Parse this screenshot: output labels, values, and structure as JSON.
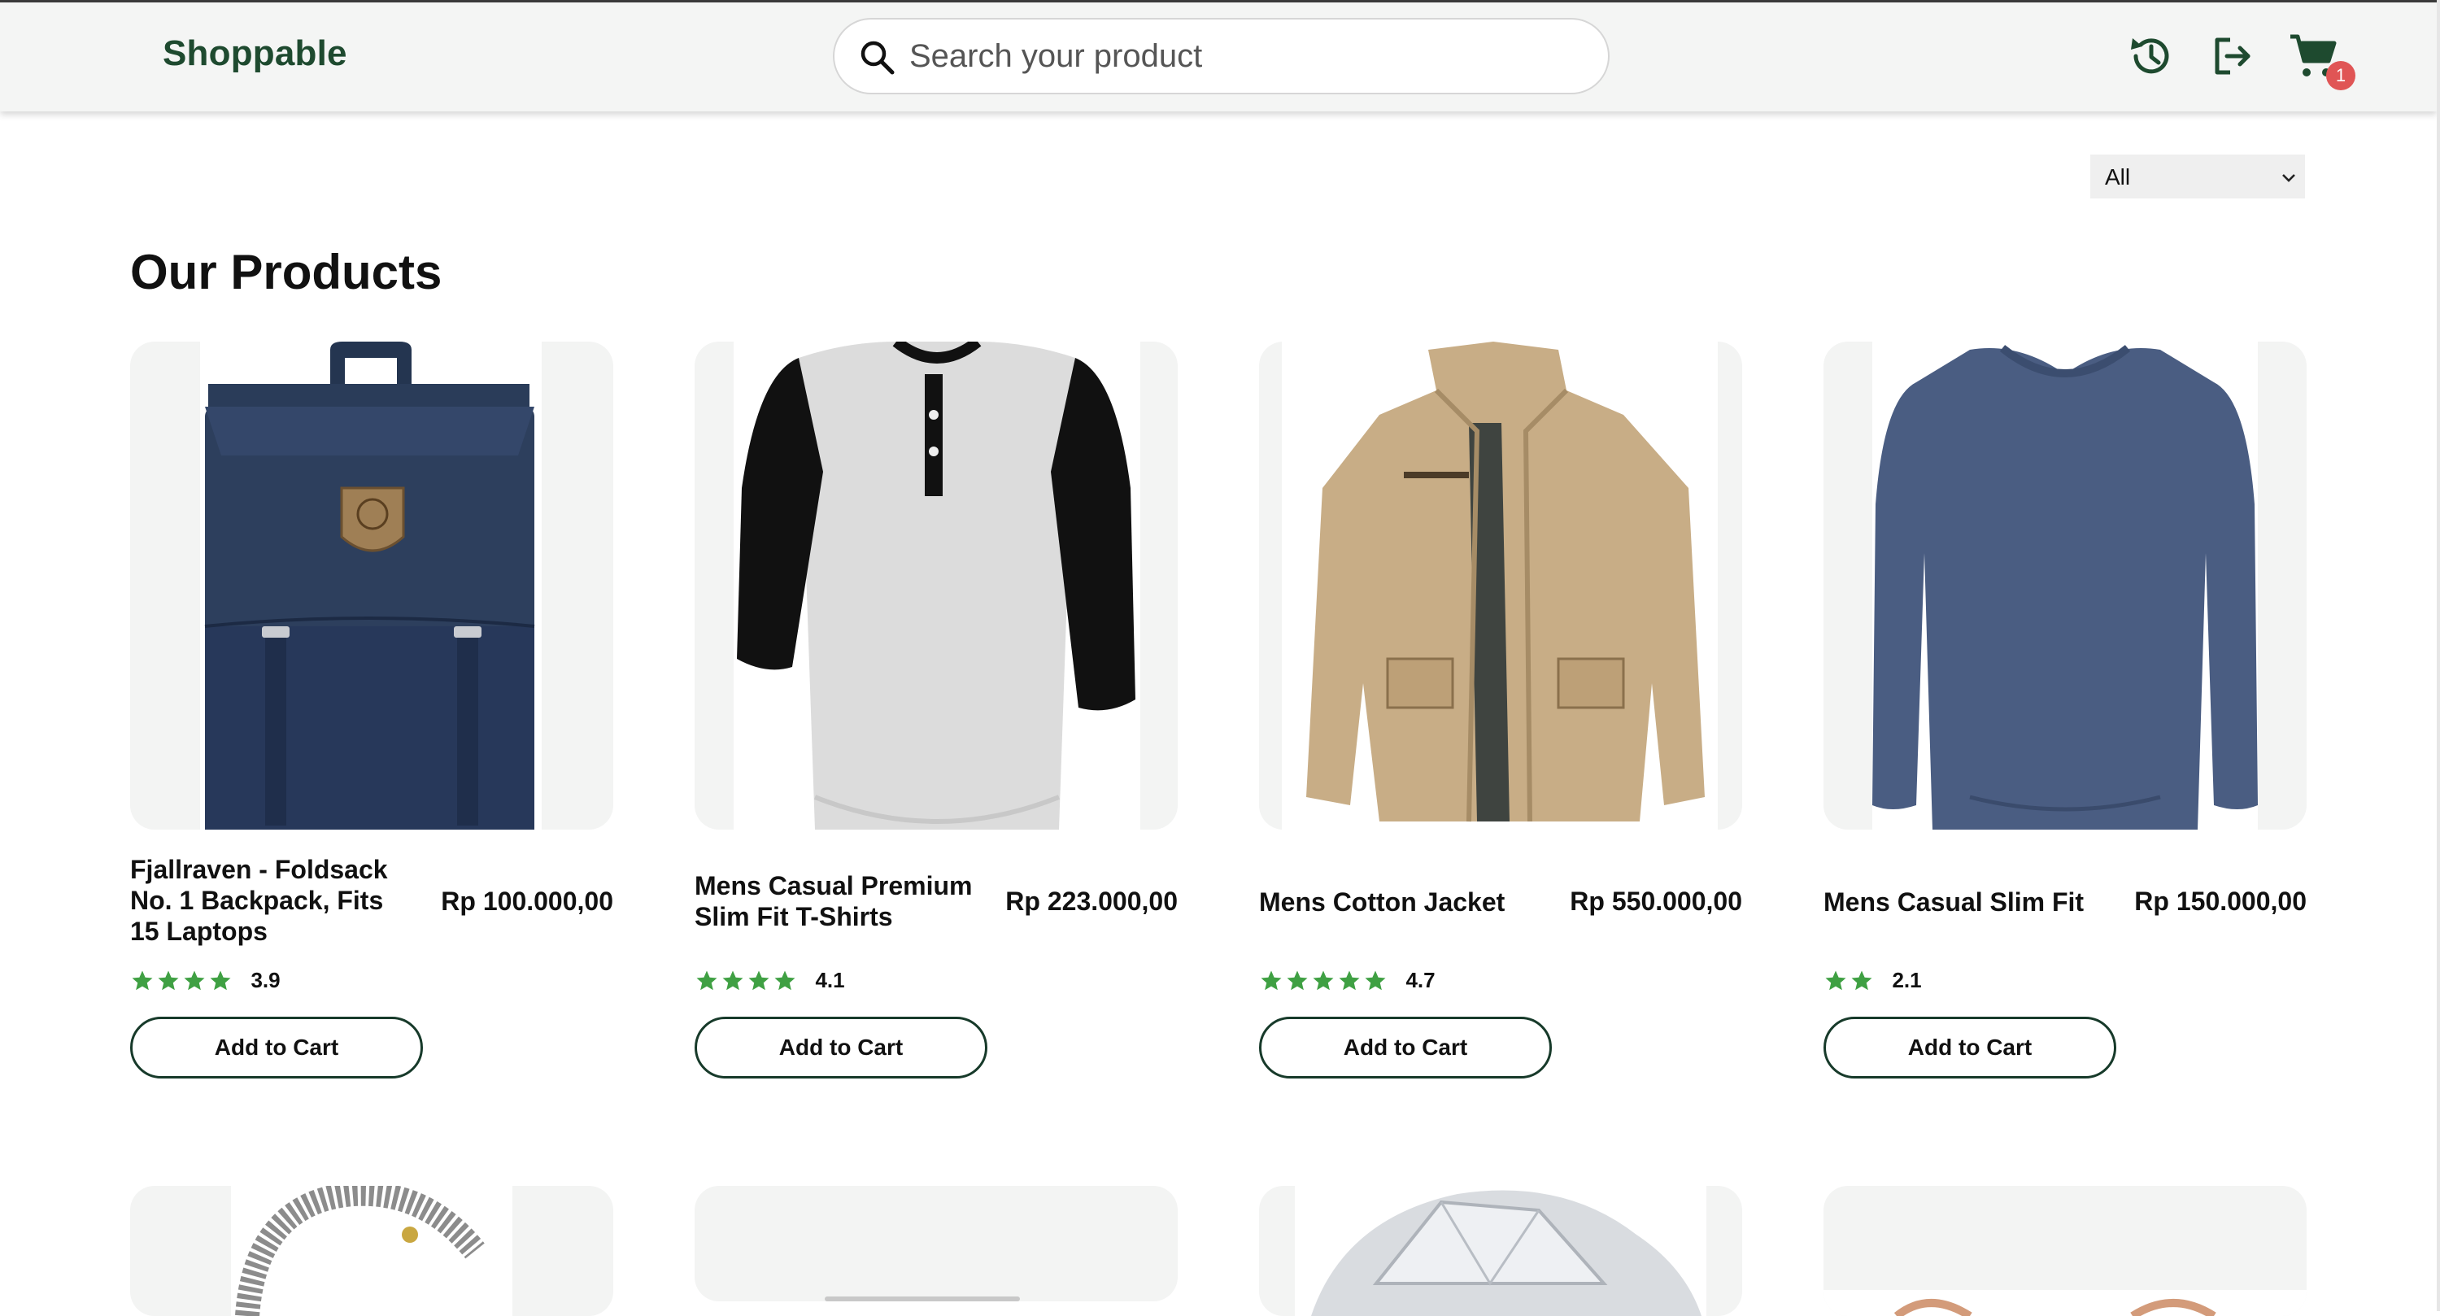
{
  "header": {
    "brand": "Shoppable",
    "search_placeholder": "Search your product",
    "cart_count": "1",
    "icons": [
      "history-icon",
      "logout-icon",
      "cart-icon"
    ]
  },
  "filter": {
    "selected": "All"
  },
  "main": {
    "title": "Our Products",
    "add_to_cart_label": "Add to Cart",
    "products": [
      {
        "name": "Fjallraven - Foldsack No. 1 Backpack, Fits 15 Laptops",
        "price": "Rp 100.000,00",
        "rating": "3.9",
        "stars": 4,
        "image": "navy backpack"
      },
      {
        "name": "Mens Casual Premium Slim Fit T-Shirts",
        "price": "Rp 223.000,00",
        "rating": "4.1",
        "stars": 4,
        "image": "grey raglan henley shirt"
      },
      {
        "name": "Mens Cotton Jacket",
        "price": "Rp 550.000,00",
        "rating": "4.7",
        "stars": 5,
        "image": "beige cotton jacket"
      },
      {
        "name": "Mens Casual Slim Fit",
        "price": "Rp 150.000,00",
        "rating": "2.1",
        "stars": 2,
        "image": "blue long sleeve shirt"
      }
    ]
  },
  "colors": {
    "brand": "#1e4a2f",
    "star": "#3fa043",
    "badge": "#e05555",
    "button_border": "#173a2a"
  }
}
